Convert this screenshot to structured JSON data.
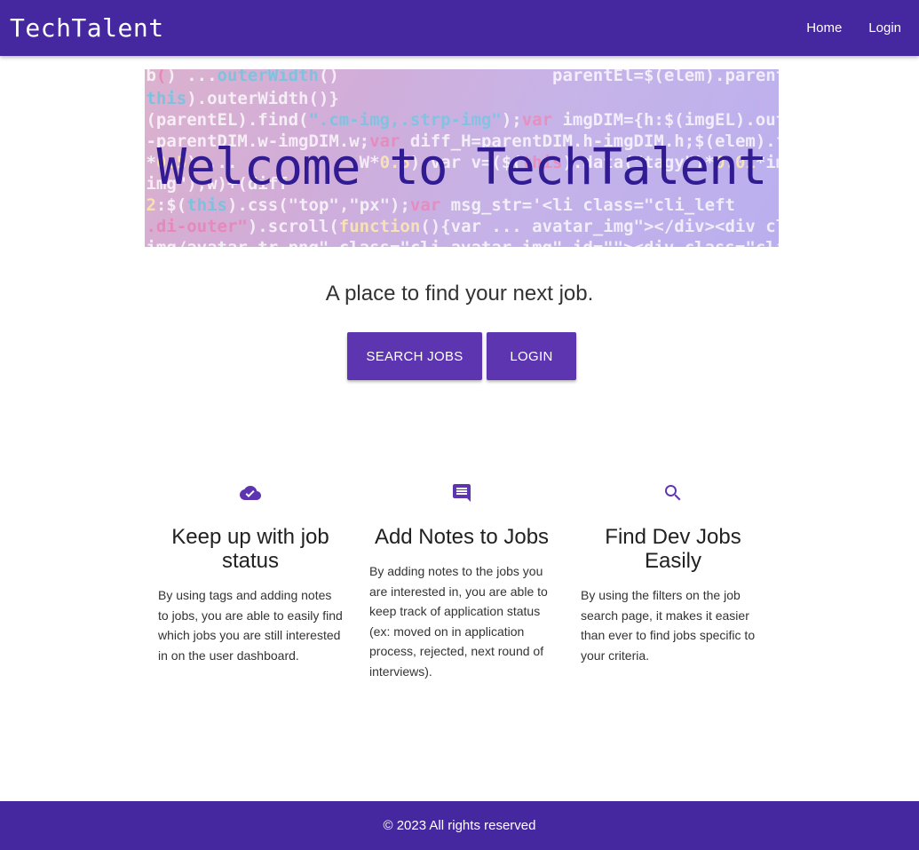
{
  "navbar": {
    "brand": "TechTalent",
    "links": [
      {
        "label": "Home"
      },
      {
        "label": "Login"
      }
    ]
  },
  "hero": {
    "title": "Welcome to TechTalent"
  },
  "main": {
    "tagline": "A place to find your next job.",
    "buttons": {
      "search_jobs": "SEARCH JOBS",
      "login": "LOGIN"
    }
  },
  "features": [
    {
      "icon": "cloud-done-icon",
      "title": "Keep up with job status",
      "text": "By using tags and adding notes to jobs, you are able to easily find which jobs you are still interested in on the user dashboard."
    },
    {
      "icon": "comment-icon",
      "title": "Add Notes to Jobs",
      "text": "By adding notes to the jobs you are interested in, you are able to keep track of application status (ex: moved on in application process, rejected, next round of interviews)."
    },
    {
      "icon": "search-icon",
      "title": "Find Dev Jobs Easily",
      "text": "By using the filters on the job search page, it makes it easier than ever to find jobs specific to your criteria."
    }
  ],
  "footer": {
    "text": "© 2023 All rights reserved"
  },
  "colors": {
    "primary": "#4527a0",
    "button": "#5e35b1",
    "hero_title": "#311b92"
  }
}
